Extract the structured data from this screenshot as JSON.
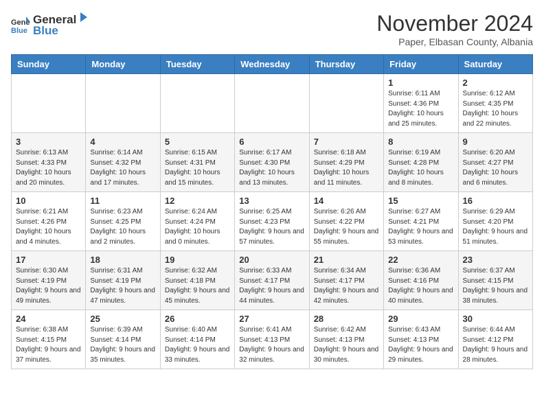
{
  "header": {
    "logo_general": "General",
    "logo_blue": "Blue",
    "month_title": "November 2024",
    "location": "Paper, Elbasan County, Albania"
  },
  "calendar": {
    "days_of_week": [
      "Sunday",
      "Monday",
      "Tuesday",
      "Wednesday",
      "Thursday",
      "Friday",
      "Saturday"
    ],
    "weeks": [
      [
        {
          "day": "",
          "info": ""
        },
        {
          "day": "",
          "info": ""
        },
        {
          "day": "",
          "info": ""
        },
        {
          "day": "",
          "info": ""
        },
        {
          "day": "",
          "info": ""
        },
        {
          "day": "1",
          "info": "Sunrise: 6:11 AM\nSunset: 4:36 PM\nDaylight: 10 hours and 25 minutes."
        },
        {
          "day": "2",
          "info": "Sunrise: 6:12 AM\nSunset: 4:35 PM\nDaylight: 10 hours and 22 minutes."
        }
      ],
      [
        {
          "day": "3",
          "info": "Sunrise: 6:13 AM\nSunset: 4:33 PM\nDaylight: 10 hours and 20 minutes."
        },
        {
          "day": "4",
          "info": "Sunrise: 6:14 AM\nSunset: 4:32 PM\nDaylight: 10 hours and 17 minutes."
        },
        {
          "day": "5",
          "info": "Sunrise: 6:15 AM\nSunset: 4:31 PM\nDaylight: 10 hours and 15 minutes."
        },
        {
          "day": "6",
          "info": "Sunrise: 6:17 AM\nSunset: 4:30 PM\nDaylight: 10 hours and 13 minutes."
        },
        {
          "day": "7",
          "info": "Sunrise: 6:18 AM\nSunset: 4:29 PM\nDaylight: 10 hours and 11 minutes."
        },
        {
          "day": "8",
          "info": "Sunrise: 6:19 AM\nSunset: 4:28 PM\nDaylight: 10 hours and 8 minutes."
        },
        {
          "day": "9",
          "info": "Sunrise: 6:20 AM\nSunset: 4:27 PM\nDaylight: 10 hours and 6 minutes."
        }
      ],
      [
        {
          "day": "10",
          "info": "Sunrise: 6:21 AM\nSunset: 4:26 PM\nDaylight: 10 hours and 4 minutes."
        },
        {
          "day": "11",
          "info": "Sunrise: 6:23 AM\nSunset: 4:25 PM\nDaylight: 10 hours and 2 minutes."
        },
        {
          "day": "12",
          "info": "Sunrise: 6:24 AM\nSunset: 4:24 PM\nDaylight: 10 hours and 0 minutes."
        },
        {
          "day": "13",
          "info": "Sunrise: 6:25 AM\nSunset: 4:23 PM\nDaylight: 9 hours and 57 minutes."
        },
        {
          "day": "14",
          "info": "Sunrise: 6:26 AM\nSunset: 4:22 PM\nDaylight: 9 hours and 55 minutes."
        },
        {
          "day": "15",
          "info": "Sunrise: 6:27 AM\nSunset: 4:21 PM\nDaylight: 9 hours and 53 minutes."
        },
        {
          "day": "16",
          "info": "Sunrise: 6:29 AM\nSunset: 4:20 PM\nDaylight: 9 hours and 51 minutes."
        }
      ],
      [
        {
          "day": "17",
          "info": "Sunrise: 6:30 AM\nSunset: 4:19 PM\nDaylight: 9 hours and 49 minutes."
        },
        {
          "day": "18",
          "info": "Sunrise: 6:31 AM\nSunset: 4:19 PM\nDaylight: 9 hours and 47 minutes."
        },
        {
          "day": "19",
          "info": "Sunrise: 6:32 AM\nSunset: 4:18 PM\nDaylight: 9 hours and 45 minutes."
        },
        {
          "day": "20",
          "info": "Sunrise: 6:33 AM\nSunset: 4:17 PM\nDaylight: 9 hours and 44 minutes."
        },
        {
          "day": "21",
          "info": "Sunrise: 6:34 AM\nSunset: 4:17 PM\nDaylight: 9 hours and 42 minutes."
        },
        {
          "day": "22",
          "info": "Sunrise: 6:36 AM\nSunset: 4:16 PM\nDaylight: 9 hours and 40 minutes."
        },
        {
          "day": "23",
          "info": "Sunrise: 6:37 AM\nSunset: 4:15 PM\nDaylight: 9 hours and 38 minutes."
        }
      ],
      [
        {
          "day": "24",
          "info": "Sunrise: 6:38 AM\nSunset: 4:15 PM\nDaylight: 9 hours and 37 minutes."
        },
        {
          "day": "25",
          "info": "Sunrise: 6:39 AM\nSunset: 4:14 PM\nDaylight: 9 hours and 35 minutes."
        },
        {
          "day": "26",
          "info": "Sunrise: 6:40 AM\nSunset: 4:14 PM\nDaylight: 9 hours and 33 minutes."
        },
        {
          "day": "27",
          "info": "Sunrise: 6:41 AM\nSunset: 4:13 PM\nDaylight: 9 hours and 32 minutes."
        },
        {
          "day": "28",
          "info": "Sunrise: 6:42 AM\nSunset: 4:13 PM\nDaylight: 9 hours and 30 minutes."
        },
        {
          "day": "29",
          "info": "Sunrise: 6:43 AM\nSunset: 4:13 PM\nDaylight: 9 hours and 29 minutes."
        },
        {
          "day": "30",
          "info": "Sunrise: 6:44 AM\nSunset: 4:12 PM\nDaylight: 9 hours and 28 minutes."
        }
      ]
    ]
  }
}
